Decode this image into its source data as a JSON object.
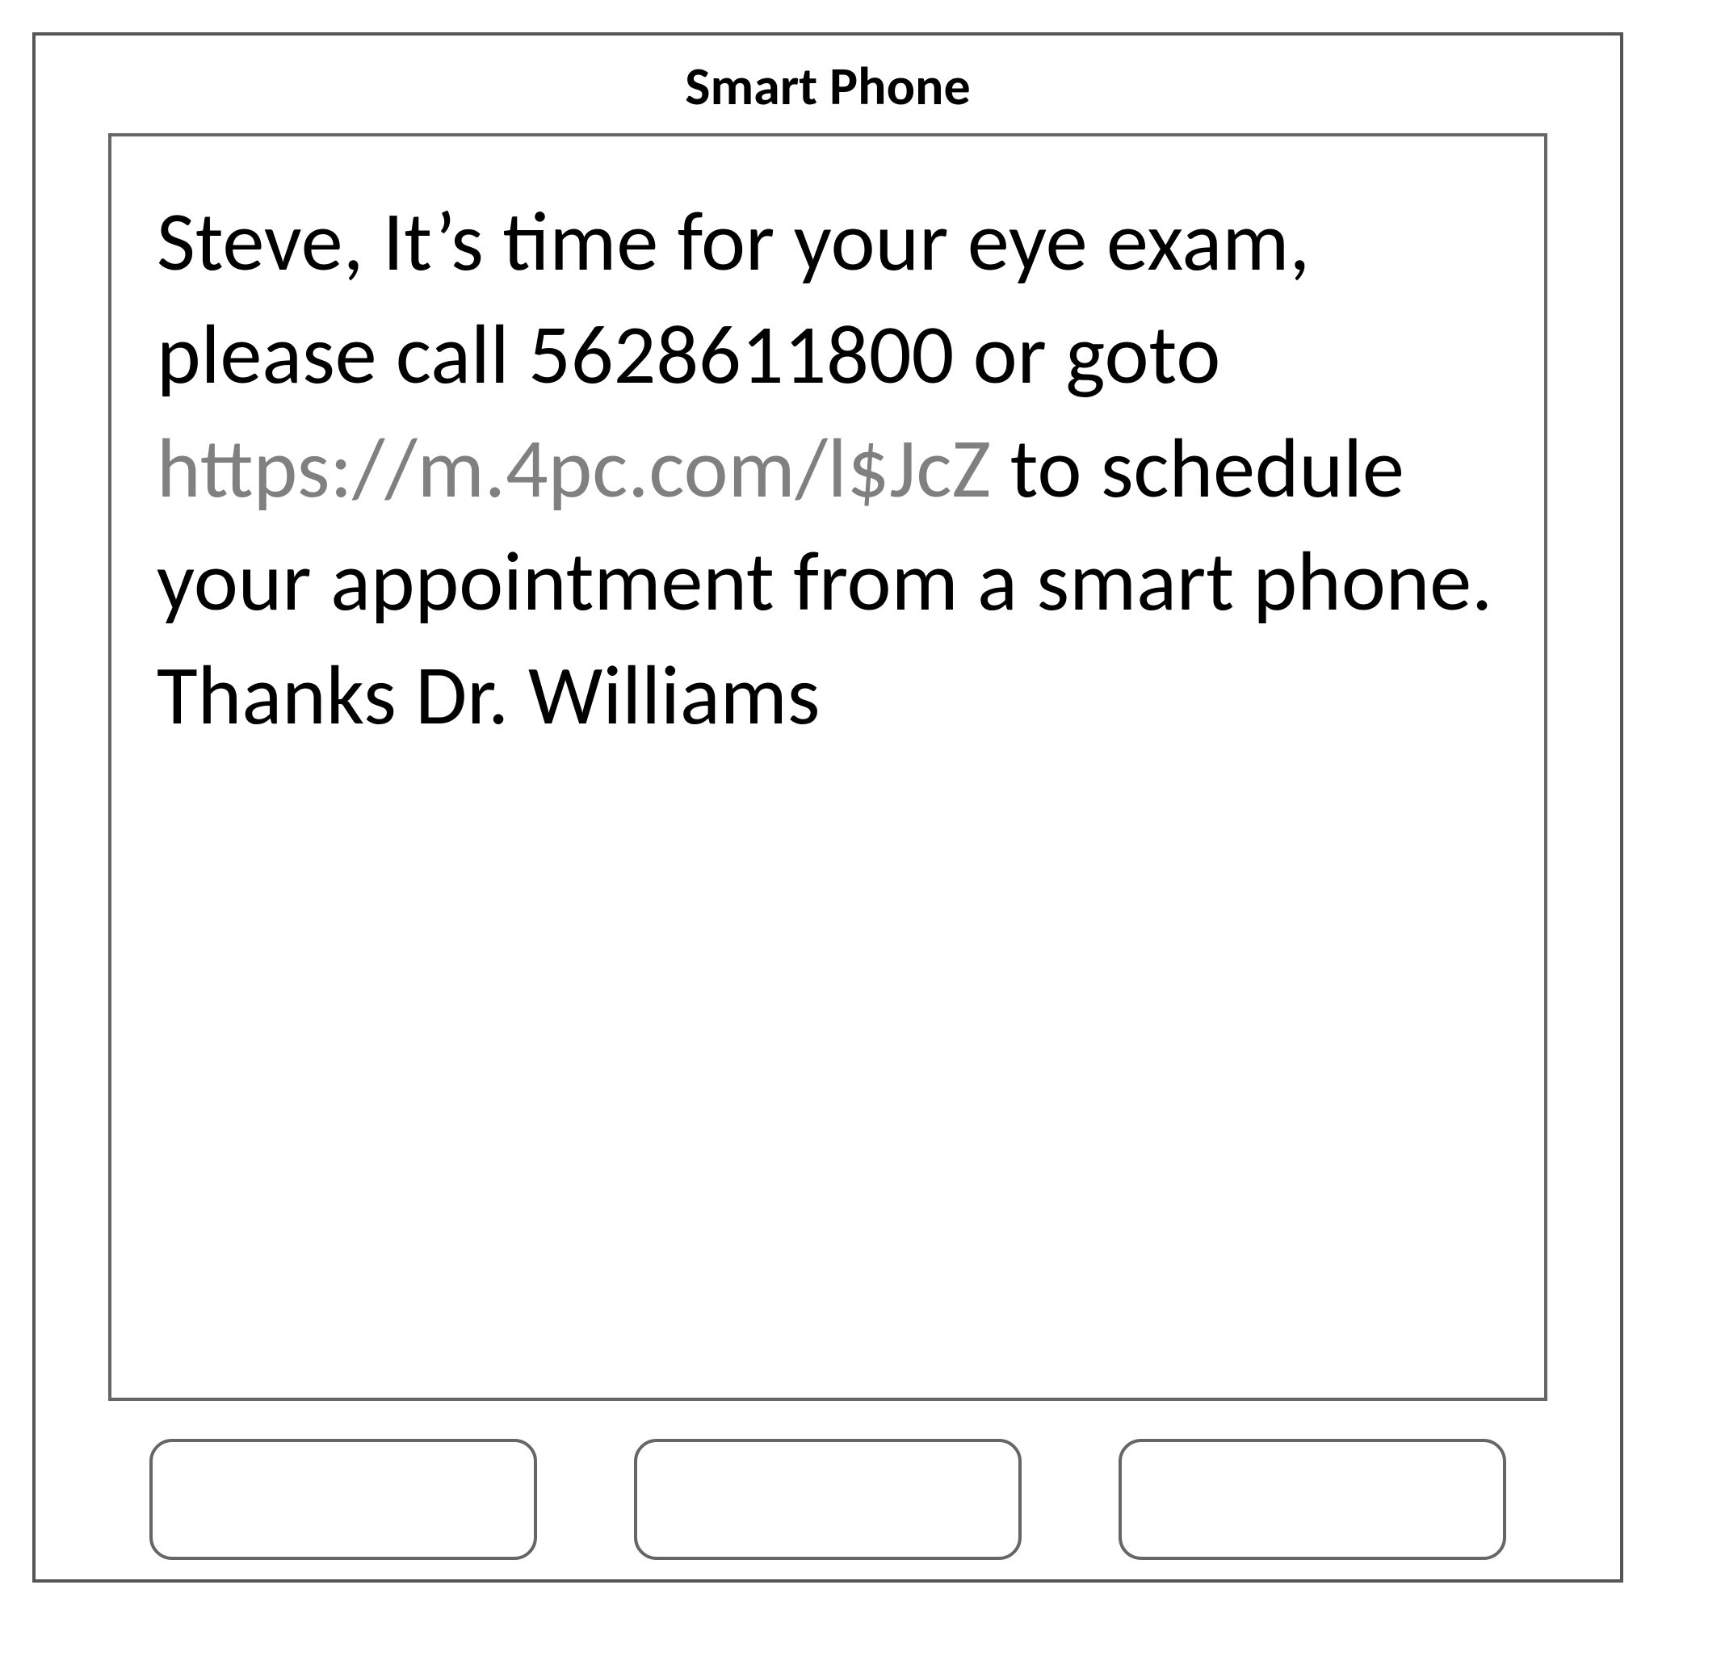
{
  "device": {
    "title": "Smart Phone"
  },
  "message": {
    "preLink": "Steve, It’s time for your eye exam, please call 5628611800 or goto ",
    "link": "https://m.4pc.com/l$JcZ",
    "postLink": " to schedule your appointment from a smart phone. Thanks Dr. Williams"
  },
  "buttons": {
    "left": "",
    "center": "",
    "right": ""
  }
}
